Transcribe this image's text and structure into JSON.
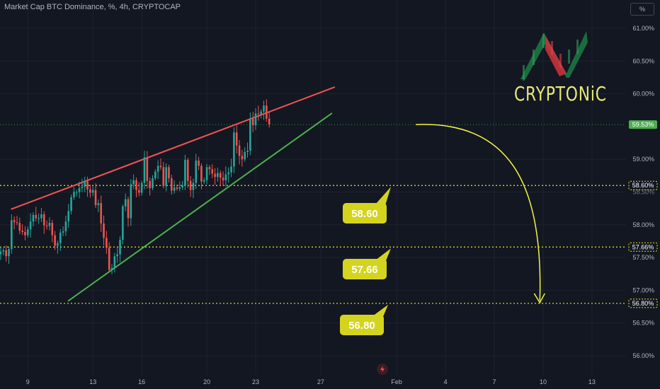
{
  "header": {
    "title": "Market Cap BTC Dominance, %, 4h, CRYPTOCAP",
    "unit_button": "%"
  },
  "logo": {
    "text": "CRYPTONiC"
  },
  "colors": {
    "background": "#131722",
    "up": "#26a69a",
    "down": "#ef5350",
    "resistance": "#f05252",
    "support": "#4caf50",
    "levels": "#e8e81c",
    "label_bg": "#d4d41f",
    "arrow": "#f5f542",
    "current_price": "#4caf50"
  },
  "icons": {
    "flash": "flash-icon",
    "logo": "cryptonic-logo-icon"
  },
  "chart_data": {
    "type": "candlestick",
    "title": "Market Cap BTC Dominance, %, 4h, CRYPTOCAP",
    "ylim": [
      55.9,
      61.2
    ],
    "y_ticks": [
      "61.00%",
      "60.50%",
      "60.00%",
      "59.00%",
      "58.50%",
      "58.00%",
      "57.50%",
      "57.00%",
      "56.50%",
      "56.00%"
    ],
    "y_tick_values": [
      61.0,
      60.5,
      60.0,
      59.0,
      58.5,
      58.0,
      57.5,
      57.0,
      56.5,
      56.0
    ],
    "x_ticks": [
      "9",
      "13",
      "16",
      "20",
      "23",
      "27",
      "Feb",
      "4",
      "7",
      "10",
      "13"
    ],
    "x_tick_index": [
      10,
      34,
      52,
      76,
      94,
      118,
      146,
      164,
      182,
      200,
      218
    ],
    "current_price": {
      "value": 59.53,
      "label": "59.53%"
    },
    "levels": [
      {
        "value": 58.6,
        "axis_label": "58.60%",
        "callout": "58.60"
      },
      {
        "value": 57.66,
        "axis_label": "57.66%",
        "callout": "57.66"
      },
      {
        "value": 56.8,
        "axis_label": "56.80%",
        "callout": "56.80"
      }
    ],
    "trendlines": [
      {
        "name": "resistance",
        "from": [
          4,
          58.24
        ],
        "to": [
          123,
          60.1
        ]
      },
      {
        "name": "support",
        "from": [
          25,
          56.84
        ],
        "to": [
          122,
          59.7
        ]
      }
    ],
    "projection": {
      "from": [
        117,
        59.53
      ],
      "to": [
        151,
        56.8
      ]
    },
    "candle_closes": [
      57.59,
      57.61,
      57.52,
      57.63,
      58.07,
      58.04,
      58.03,
      57.91,
      57.89,
      57.84,
      57.93,
      58.05,
      58.15,
      58.1,
      58.1,
      58.16,
      57.99,
      57.98,
      58.03,
      57.84,
      57.68,
      57.72,
      57.88,
      57.9,
      58.05,
      58.21,
      58.42,
      58.5,
      58.5,
      58.56,
      58.58,
      58.66,
      58.54,
      58.49,
      58.53,
      58.3,
      58.33,
      58.02,
      57.8,
      57.65,
      57.31,
      57.34,
      57.52,
      57.55,
      57.77,
      58.28,
      58.39,
      58.1,
      58.62,
      58.68,
      58.53,
      58.49,
      58.64,
      59.03,
      58.67,
      58.56,
      58.71,
      58.81,
      58.9,
      58.88,
      58.59,
      58.88,
      58.71,
      58.52,
      58.57,
      58.55,
      58.57,
      58.6,
      58.99,
      58.67,
      58.53,
      58.64,
      58.98,
      58.9,
      58.66,
      58.68,
      58.88,
      58.85,
      58.78,
      58.73,
      58.79,
      58.72,
      58.68,
      58.77,
      58.8,
      58.89,
      59.41,
      59.21,
      59.05,
      59.0,
      59.11,
      59.13,
      59.62,
      59.52,
      59.7,
      59.69,
      59.73,
      59.82,
      59.62,
      59.53
    ]
  }
}
